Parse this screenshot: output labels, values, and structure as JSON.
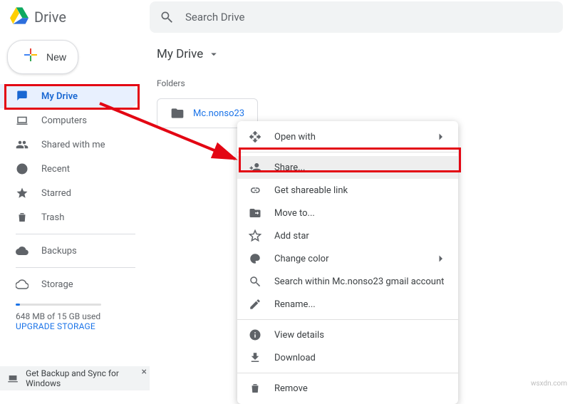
{
  "app": {
    "brand": "Drive"
  },
  "search": {
    "placeholder": "Search Drive"
  },
  "sidebar": {
    "new_label": "New",
    "items": [
      {
        "label": "My Drive"
      },
      {
        "label": "Computers"
      },
      {
        "label": "Shared with me"
      },
      {
        "label": "Recent"
      },
      {
        "label": "Starred"
      },
      {
        "label": "Trash"
      },
      {
        "label": "Backups"
      },
      {
        "label": "Storage"
      }
    ],
    "storage_used": "648 MB of 15 GB used",
    "upgrade": "UPGRADE STORAGE"
  },
  "main": {
    "crumb": "My Drive",
    "section": "Folders",
    "folder_name": "Mc.nonso23"
  },
  "ctx": {
    "open_with": "Open with",
    "share": "Share...",
    "link": "Get shareable link",
    "move": "Move to...",
    "star": "Add star",
    "color": "Change color",
    "search_within": "Search within Mc.nonso23 gmail account",
    "rename": "Rename...",
    "details": "View details",
    "download": "Download",
    "remove": "Remove"
  },
  "footer": {
    "text": "Get Backup and Sync for Windows"
  },
  "watermark": "wsxdn.com"
}
